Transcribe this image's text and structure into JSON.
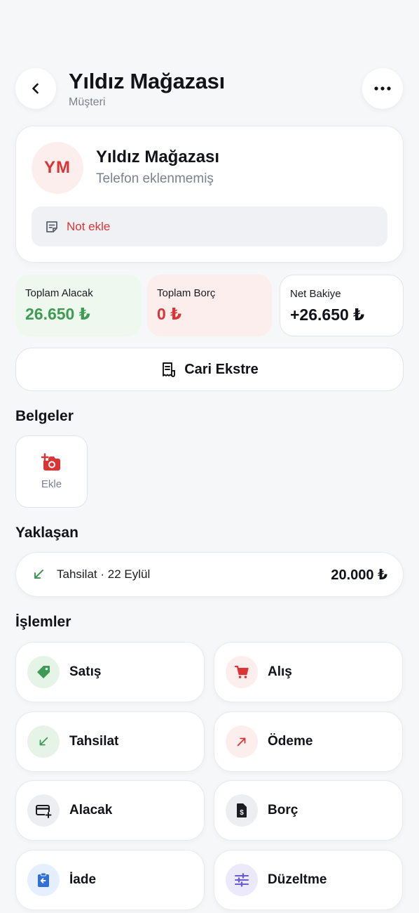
{
  "header": {
    "title": "Yıldız Mağazası",
    "subtitle": "Müşteri"
  },
  "customer": {
    "initials": "YM",
    "name": "Yıldız Mağazası",
    "phone": "Telefon eklenmemiş",
    "note_label": "Not ekle"
  },
  "stats": [
    {
      "label": "Toplam Alacak",
      "value": "26.650 ₺"
    },
    {
      "label": "Toplam Borç",
      "value": "0 ₺"
    },
    {
      "label": "Net Bakiye",
      "value": "+26.650 ₺"
    }
  ],
  "statement_button": "Cari Ekstre",
  "documents": {
    "title": "Belgeler",
    "add_label": "Ekle"
  },
  "upcoming": {
    "title": "Yaklaşan",
    "item": {
      "description": "Tahsilat · 22 Eylül",
      "amount": "20.000 ₺"
    }
  },
  "actions": {
    "title": "İşlemler",
    "items": [
      {
        "label": "Satış",
        "icon": "tag-icon"
      },
      {
        "label": "Alış",
        "icon": "cart-icon"
      },
      {
        "label": "Tahsilat",
        "icon": "arrow-down-left-icon"
      },
      {
        "label": "Ödeme",
        "icon": "arrow-up-right-icon"
      },
      {
        "label": "Alacak",
        "icon": "card-plus-icon"
      },
      {
        "label": "Borç",
        "icon": "invoice-icon"
      },
      {
        "label": "İade",
        "icon": "return-icon"
      },
      {
        "label": "Düzeltme",
        "icon": "sliders-icon"
      }
    ]
  },
  "colors": {
    "green": "#3f9a54",
    "red": "#d93535",
    "purple": "#6b5bd6",
    "blue": "#2f6fd8"
  }
}
